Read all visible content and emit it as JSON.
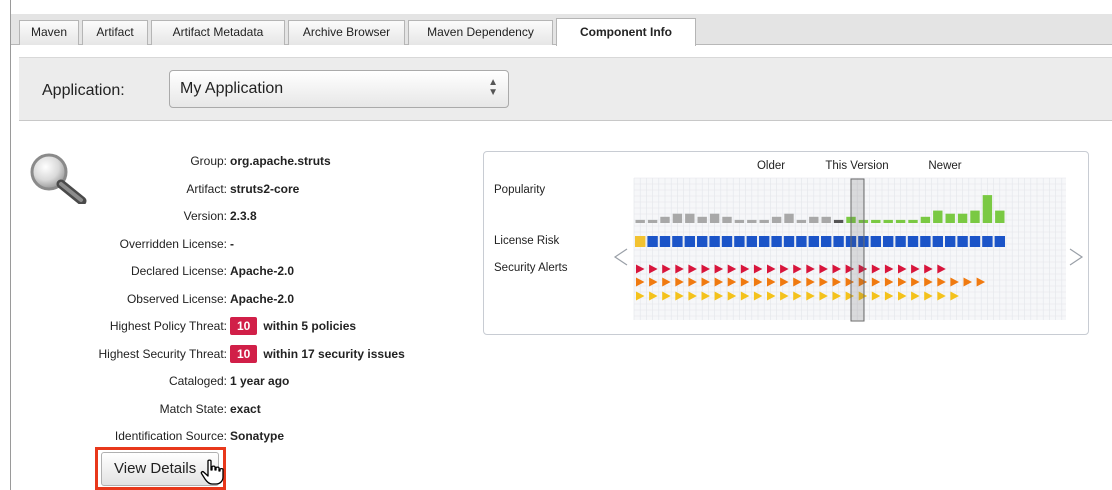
{
  "tabs": [
    {
      "label": "Maven"
    },
    {
      "label": "Artifact"
    },
    {
      "label": "Artifact Metadata"
    },
    {
      "label": "Archive Browser"
    },
    {
      "label": "Maven Dependency"
    },
    {
      "label": "Component Info"
    }
  ],
  "active_tab": "Component Info",
  "application": {
    "label": "Application:",
    "selected": "My Application"
  },
  "component": {
    "icon": "magnifier-icon",
    "fields": [
      {
        "label": "Group:",
        "value": "org.apache.struts"
      },
      {
        "label": "Artifact:",
        "value": "struts2-core"
      },
      {
        "label": "Version:",
        "value": "2.3.8"
      },
      {
        "label": "Overridden License:",
        "value": "-"
      },
      {
        "label": "Declared License:",
        "value": "Apache-2.0"
      },
      {
        "label": "Observed License:",
        "value": "Apache-2.0"
      },
      {
        "label": "Highest Policy Threat:",
        "badge": "10",
        "value": "within 5 policies"
      },
      {
        "label": "Highest Security Threat:",
        "badge": "10",
        "value": "within 17 security issues"
      },
      {
        "label": "Cataloged:",
        "value": "1 year ago"
      },
      {
        "label": "Match State:",
        "value": "exact"
      },
      {
        "label": "Identification Source:",
        "value": "Sonatype"
      }
    ],
    "details_button": "View Details"
  },
  "version_chart": {
    "header": {
      "older": "Older",
      "this_version": "This Version",
      "newer": "Newer"
    },
    "rows": {
      "popularity": "Popularity",
      "license_risk": "License Risk",
      "security_alerts": "Security Alerts"
    },
    "selected_index": 16,
    "popularity": [
      1,
      1,
      2,
      3,
      3,
      2,
      3,
      2,
      1,
      1,
      1,
      2,
      3,
      1,
      2,
      2,
      1,
      2,
      1,
      1,
      1,
      1,
      1,
      2,
      4,
      3,
      3,
      4,
      9,
      4
    ],
    "license_risk": [
      "yellow",
      "blue",
      "blue",
      "blue",
      "blue",
      "blue",
      "blue",
      "blue",
      "blue",
      "blue",
      "blue",
      "blue",
      "blue",
      "blue",
      "blue",
      "blue",
      "blue",
      "blue",
      "blue",
      "blue",
      "blue",
      "blue",
      "blue",
      "blue",
      "blue",
      "blue",
      "blue",
      "blue",
      "blue",
      "blue"
    ],
    "alerts_red": 24,
    "alerts_orange": 27,
    "alerts_yellow": 25,
    "colors": {
      "popularity_older": "#a8a8a8",
      "popularity_this": "#555555",
      "popularity_newer": "#7ac943",
      "license_blue": "#1b54c8",
      "license_yellow": "#f2c230",
      "alert_red": "#d8153c",
      "alert_orange": "#f07a10",
      "alert_yellow": "#f4c21c",
      "threat_badge": "#d11f48",
      "highlight_box": "#e8381b"
    }
  }
}
